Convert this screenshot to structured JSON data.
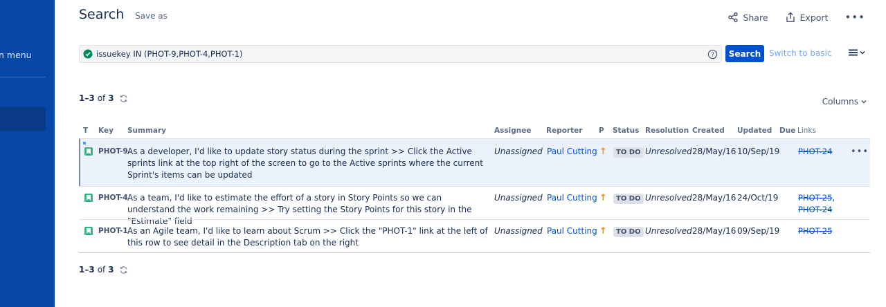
{
  "sidebar": {
    "menu_label": "n menu"
  },
  "page": {
    "title": "Search",
    "save_as": "Save as"
  },
  "top_actions": {
    "share": "Share",
    "export": "Export",
    "more": "•••"
  },
  "search": {
    "jql": "issuekey IN (PHOT-9,PHOT-4,PHOT-1)",
    "button": "Search",
    "switch_basic": "Switch to basic"
  },
  "pagination": {
    "range": "1–3",
    "of": "of",
    "total": "3"
  },
  "columns_button": "Columns",
  "table": {
    "headers": {
      "type": "T",
      "key": "Key",
      "summary": "Summary",
      "assignee": "Assignee",
      "reporter": "Reporter",
      "priority": "P",
      "status": "Status",
      "resolution": "Resolution",
      "created": "Created",
      "updated": "Updated",
      "due": "Due",
      "links": "Links"
    },
    "rows": [
      {
        "key": "PHOT-9",
        "summary": "As a developer, I'd like to update story status during the sprint >> Click the Active sprints link at the top right of the screen to go to the Active sprints where the current Sprint's items can be updated",
        "assignee": "Unassigned",
        "reporter": "Paul Cutting",
        "priority": "↑",
        "status": "TO DO",
        "resolution": "Unresolved",
        "created": "28/May/16",
        "updated": "10/Sep/19",
        "links": [
          "PHOT-24"
        ],
        "actions": "•••"
      },
      {
        "key": "PHOT-4",
        "summary": "As a team, I'd like to estimate the effort of a story in Story Points so we can understand the work remaining >> Try setting the Story Points for this story in the \"Estimate\" field",
        "assignee": "Unassigned",
        "reporter": "Paul Cutting",
        "priority": "↑",
        "status": "TO DO",
        "resolution": "Unresolved",
        "created": "28/May/16",
        "updated": "24/Oct/19",
        "links": [
          "PHOT-25",
          "PHOT-24"
        ]
      },
      {
        "key": "PHOT-1",
        "summary": "As an Agile team, I'd like to learn about Scrum >> Click the \"PHOT-1\" link at the left of this row to see detail in the Description tab on the right",
        "assignee": "Unassigned",
        "reporter": "Paul Cutting",
        "priority": "↑",
        "status": "TO DO",
        "resolution": "Unresolved",
        "created": "28/May/16",
        "updated": "09/Sep/19",
        "links": [
          "PHOT-25"
        ]
      }
    ]
  },
  "colors": {
    "sidebar": "#0747a6",
    "primary": "#0052cc",
    "success": "#00875a",
    "priority_high": "#ff8b00",
    "story": "#36b37e"
  }
}
